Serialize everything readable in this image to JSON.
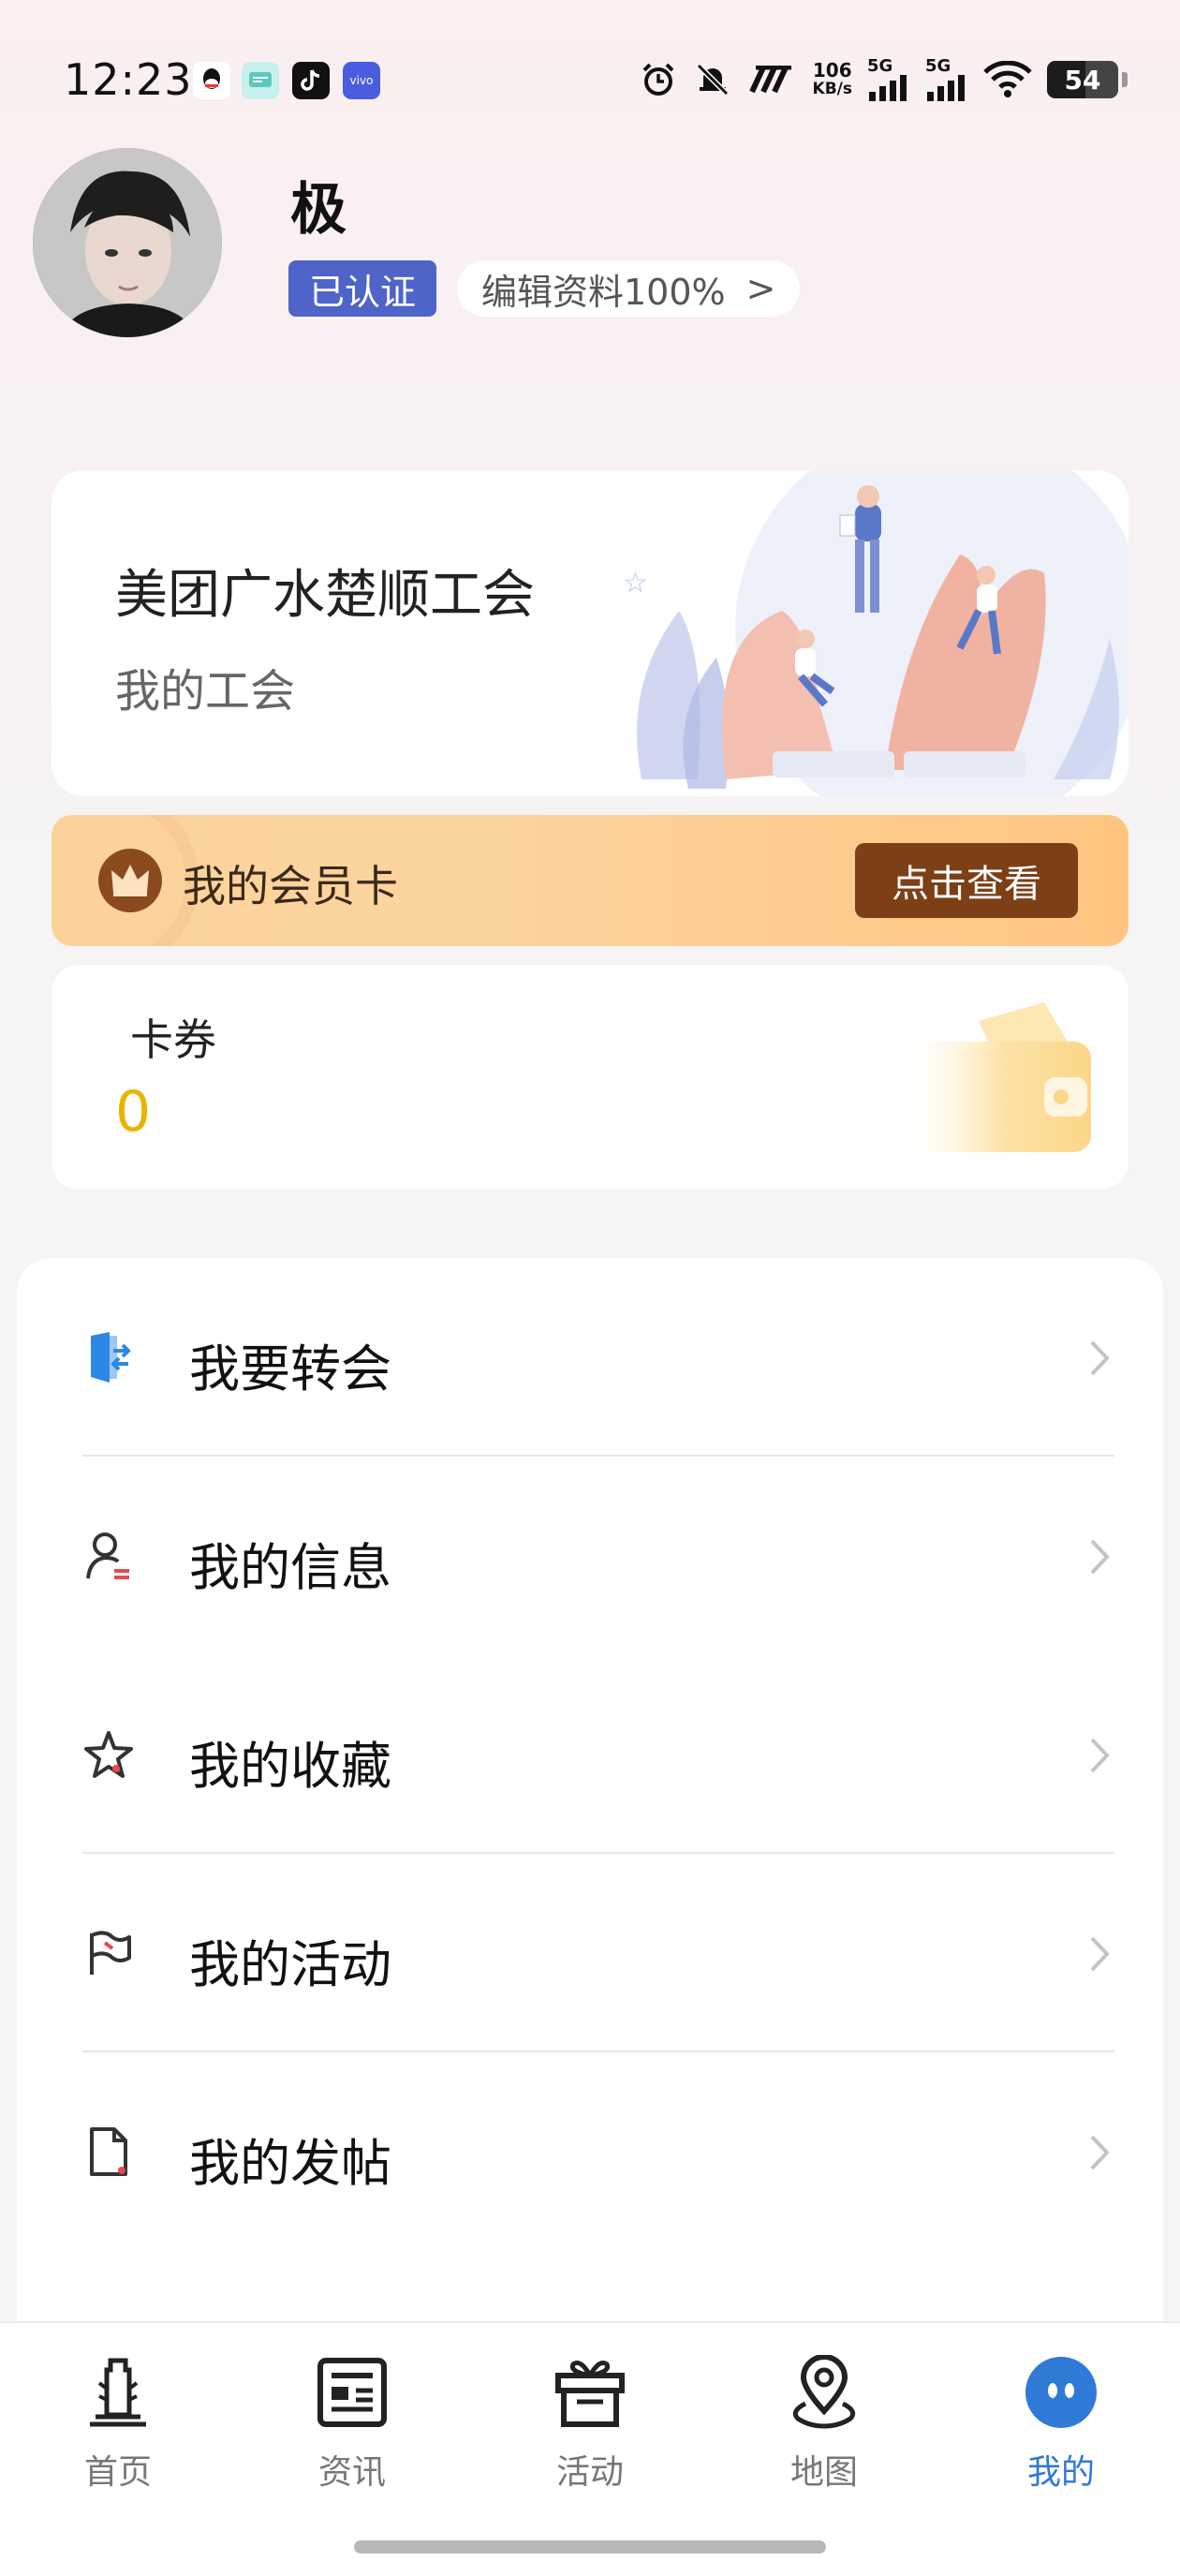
{
  "status_bar": {
    "time": "12:23",
    "app_icons": [
      "qq-icon",
      "message-icon",
      "tiktok-icon",
      "vivo-icon"
    ],
    "net_speed_value": "106",
    "net_speed_unit": "KB/s",
    "signal_1": "5G",
    "signal_2": "5G",
    "battery": "54",
    "battery_level": 0.54
  },
  "profile": {
    "username": "极",
    "verified_badge": "已认证",
    "edit_profile": "编辑资料100%",
    "edit_arrow": ">"
  },
  "union_card": {
    "name": "美团广水楚顺工会",
    "subtitle": "我的工会"
  },
  "member_card": {
    "label": "我的会员卡",
    "button": "点击查看"
  },
  "coupon": {
    "label": "卡券",
    "count": "0"
  },
  "menu": {
    "items": [
      {
        "label": "我要转会",
        "icon": "transfer-door-icon"
      },
      {
        "label": "我的信息",
        "icon": "person-info-icon"
      },
      {
        "label": "我的收藏",
        "icon": "star-icon"
      },
      {
        "label": "我的活动",
        "icon": "flag-icon"
      },
      {
        "label": "我的发帖",
        "icon": "document-icon"
      }
    ]
  },
  "bottom_nav": {
    "items": [
      {
        "label": "首页",
        "icon": "home-tower-icon"
      },
      {
        "label": "资讯",
        "icon": "news-icon"
      },
      {
        "label": "活动",
        "icon": "gift-icon"
      },
      {
        "label": "地图",
        "icon": "map-pin-icon"
      },
      {
        "label": "我的",
        "icon": "profile-face-icon"
      }
    ],
    "active_index": 4
  },
  "colors": {
    "accent_blue": "#2e7ad6",
    "verified_blue": "#4e64c8",
    "member_button_brown": "#7d3f16",
    "coupon_yellow": "#e9b400"
  }
}
